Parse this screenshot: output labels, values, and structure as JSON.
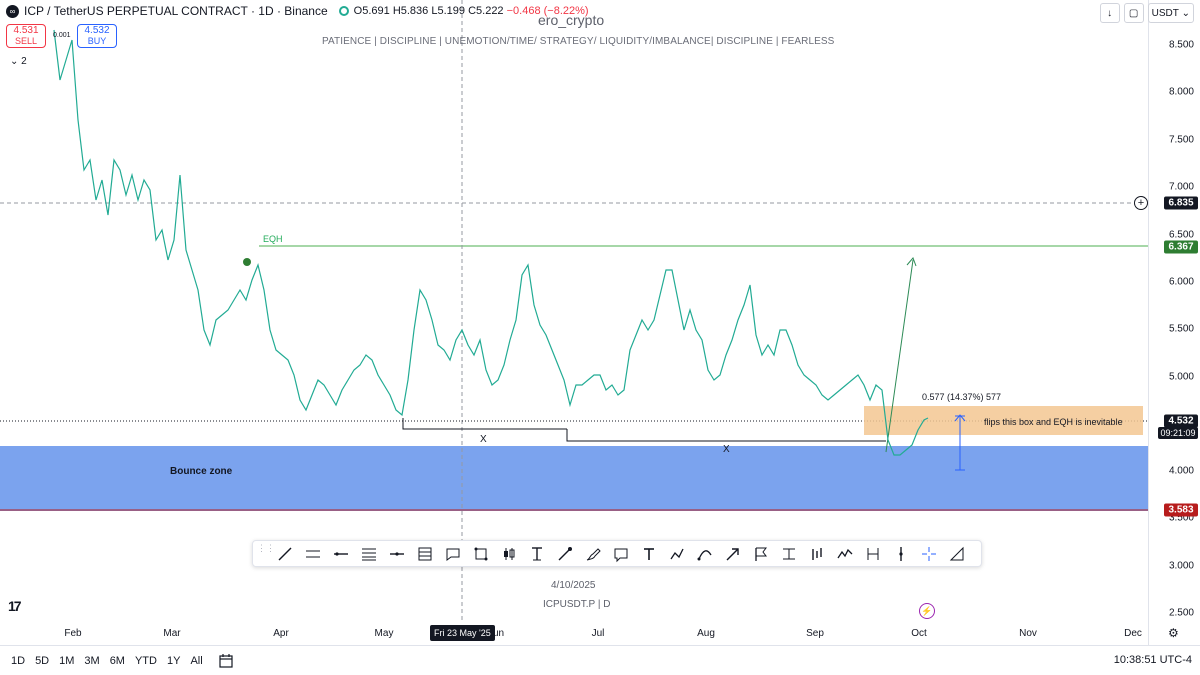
{
  "header": {
    "symbol_title": "ICP / TetherUS PERPETUAL CONTRACT · 1D · Binance",
    "ohlc": {
      "open": "O5.691",
      "high": "H5.836",
      "low": "L5.199",
      "close": "C5.222",
      "change": "−0.468 (−8.22%)"
    },
    "sell": {
      "value": "4.531",
      "label": "SELL"
    },
    "buy": {
      "value": "4.532",
      "label": "BUY"
    },
    "spread": "0.001",
    "indicators_toggle": "⌄ 2"
  },
  "watermark": {
    "title": "ero_crypto",
    "subtitle": "PATIENCE   |   DISCIPLINE   |   UNEMOTION/TIME/ STRATEGY/ LIQUIDITY/IMBALANCE|   DISCIPLINE   |   FEARLESS",
    "date": "4/10/2025",
    "symbol": "ICPUSDT.P  |  D"
  },
  "top_controls": {
    "currency": "USDT",
    "icons": [
      "arrow-down-icon",
      "screenshot-icon"
    ]
  },
  "price_scale": {
    "ticks": [
      "8.500",
      "8.000",
      "7.500",
      "7.000",
      "6.500",
      "6.000",
      "5.500",
      "5.000",
      "4.000",
      "3.000",
      "2.500"
    ],
    "tags": {
      "crosshair": "6.835",
      "eqh": "6.367",
      "current": "4.532",
      "countdown": "09:21:09",
      "support": "3.583",
      "partial_tick": "3.500"
    },
    "colors": {
      "eqh": "#2e7d32",
      "current": "#131722",
      "support": "#b71c1c",
      "crosshair": "#131722"
    }
  },
  "time_axis": {
    "ticks": [
      "Feb",
      "Mar",
      "Apr",
      "May",
      "Jun",
      "Jul",
      "Aug",
      "Sep",
      "Oct",
      "Nov",
      "Dec"
    ],
    "crosshair_date": "Fri 23 May '25"
  },
  "annotations": {
    "eqh": "EQH",
    "bounce_zone": "Bounce zone",
    "x1": "X",
    "x2": "X",
    "measure": "0.577 (14.37%) 577",
    "note": "flips this box and EQH is inevitable"
  },
  "colors": {
    "bull": "#22ab94",
    "bear": "#131722",
    "bounce_zone": "#6d99ec",
    "box": "#f3c792",
    "eqh_line": "#4caf50",
    "support_line": "#b71c1c",
    "arrow": "#2e8b57",
    "measure": "#2962ff"
  },
  "drawing_tools": [
    "trend-line-icon",
    "parallel-channel-icon",
    "horizontal-ray-icon",
    "fib-retracement-icon",
    "horizontal-line-icon",
    "pitchfork-icon",
    "callout-icon",
    "rectangle-icon",
    "candles-icon",
    "text-anchor-icon",
    "arrow-marker-icon",
    "brush-icon",
    "comment-icon",
    "text-icon",
    "path-icon",
    "curve-icon",
    "arrow-icon",
    "flag-icon",
    "price-range-icon",
    "bars-pattern-icon",
    "forecast-icon",
    "date-range-icon",
    "vertical-line-icon",
    "crosshair-icon",
    "ruler-icon"
  ],
  "bottom_bar": {
    "ranges": [
      "1D",
      "5D",
      "1M",
      "3M",
      "6M",
      "YTD",
      "1Y",
      "All"
    ],
    "clock": "10:38:51 UTC-4"
  }
}
